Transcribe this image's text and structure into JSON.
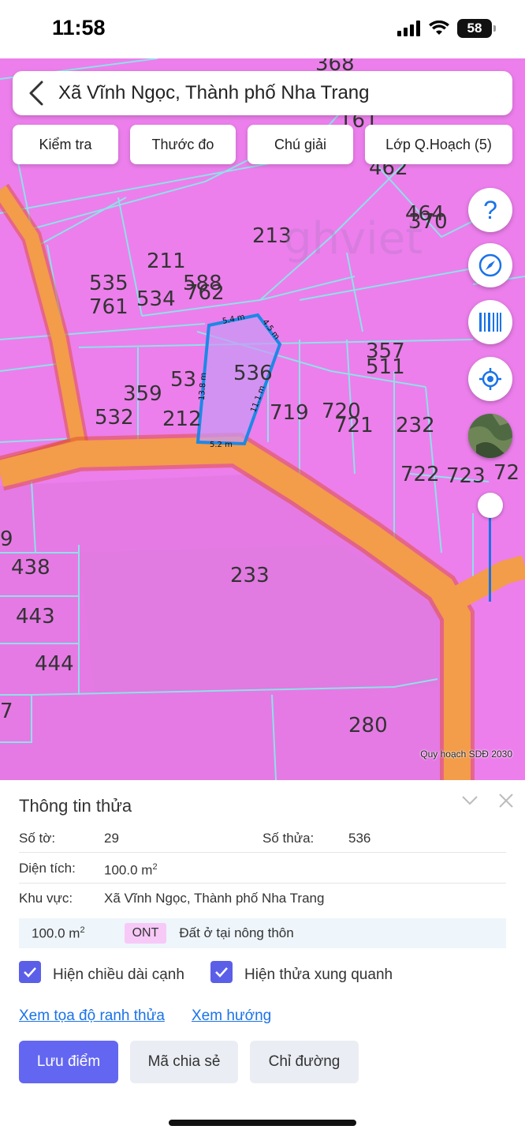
{
  "status": {
    "time": "11:58",
    "battery": "58"
  },
  "header": {
    "title": "Xã Vĩnh Ngọc, Thành phố Nha Trang"
  },
  "toolbar": {
    "buttons": [
      "Kiểm tra",
      "Thước đo",
      "Chú giải",
      "Lớp Q.Hoạch (5)"
    ]
  },
  "tools": {
    "help_label": "?"
  },
  "map": {
    "attribution": "Quy hoạch SDĐ 2030",
    "parcel_labels": [
      "368",
      "161",
      "462",
      "464",
      "370",
      "213",
      "211",
      "535",
      "761",
      "534",
      "588",
      "762",
      "357",
      "511",
      "359",
      "532",
      "53",
      "212",
      "536",
      "719",
      "720",
      "721",
      "232",
      "722",
      "723",
      "72",
      "9",
      "438",
      "233",
      "443",
      "444",
      "280",
      "7"
    ],
    "edge_labels": [
      "5.4 m",
      "4.5 m",
      "13.8 m",
      "11.1 m",
      "5.2 m"
    ],
    "watermark": "ghviet"
  },
  "sheet": {
    "title": "Thông tin thửa",
    "so_to_label": "Số tờ:",
    "so_to_value": "29",
    "so_thua_label": "Số thửa:",
    "so_thua_value": "536",
    "dien_tich_label": "Diện tích:",
    "dien_tich_value": "100.0 m",
    "khu_vuc_label": "Khu vực:",
    "khu_vuc_value": "Xã Vĩnh Ngọc, Thành phố Nha Trang",
    "use_area": "100.0 m",
    "use_code": "ONT",
    "use_desc": "Đất ở tại nông thôn",
    "sup": "2",
    "checkbox_1": "Hiện chiều dài cạnh",
    "checkbox_2": "Hiện thửa xung quanh",
    "link_1": "Xem tọa độ ranh thửa",
    "link_2": "Xem hướng",
    "btn_save": "Lưu điểm",
    "btn_share": "Mã chia sẻ",
    "btn_direction": "Chỉ đường"
  },
  "colors": {
    "zone": "#ec7fec",
    "road": "#f39c4a",
    "accent": "#6366f1",
    "link": "#1a73e8"
  }
}
